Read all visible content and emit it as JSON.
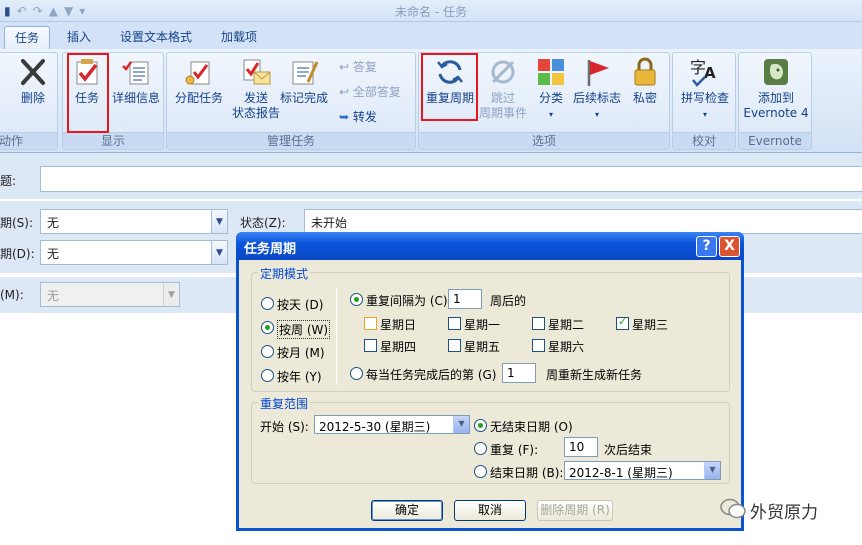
{
  "window": {
    "title": "未命名 - 任务",
    "qat_icons": [
      "save-icon",
      "undo-icon",
      "redo-icon",
      "up-icon",
      "down-icon"
    ]
  },
  "tabs": [
    "任务",
    "插入",
    "设置文本格式",
    "加载项"
  ],
  "ribbon": {
    "groups": {
      "actions": "动作",
      "show": "显示",
      "manage": "管理任务",
      "options": "选项",
      "proofing": "校对",
      "evernote": "Evernote"
    },
    "buttons": {
      "delete": "删除",
      "task": "任务",
      "details": "详细信息",
      "assign": "分配任务",
      "send_status_1": "发送",
      "send_status_2": "状态报告",
      "mark_complete": "标记完成",
      "reply": "答复",
      "reply_all": "全部答复",
      "forward": "转发",
      "recurrence": "重复周期",
      "skip_1": "跳过",
      "skip_2": "周期事件",
      "categorize": "分类",
      "followup": "后续标志",
      "private": "私密",
      "spelling": "拼写检查",
      "evernote_1": "添加到",
      "evernote_2": "Evernote 4"
    },
    "highlight_color": "#e8171d"
  },
  "form": {
    "subject_label": "题:",
    "start_label": "期(S):",
    "start_value": "无",
    "due_label": "期(D):",
    "due_value": "无",
    "status_label": "状态(Z):",
    "status_value": "未开始",
    "reminder_label": "(M):",
    "reminder_value": "无"
  },
  "dialog": {
    "title": "任务周期",
    "help": "?",
    "close": "X",
    "pattern_title": "定期模式",
    "daily": "按天 (D)",
    "weekly": "按周 (W)",
    "monthly": "按月 (M)",
    "yearly": "按年 (Y)",
    "recur_every": "重复间隔为 (C)",
    "recur_value": "1",
    "weeks_on": "周后的",
    "days": [
      "星期日",
      "星期一",
      "星期二",
      "星期三",
      "星期四",
      "星期五",
      "星期六"
    ],
    "days_checked": [
      false,
      false,
      false,
      true,
      false,
      false,
      false
    ],
    "regenerate": "每当任务完成后的第 (G)",
    "regenerate_value": "1",
    "regenerate_suffix": "周重新生成新任务",
    "range_title": "重复范围",
    "start_label": "开始 (S):",
    "start_value": "2012-5-30 (星期三)",
    "no_end": "无结束日期 (O)",
    "end_after": "重复 (F):",
    "end_after_value": "10",
    "end_after_suffix": "次后结束",
    "end_by": "结束日期 (B):",
    "end_by_value": "2012-8-1 (星期三)",
    "ok": "确定",
    "cancel": "取消",
    "remove": "删除周期 (R)"
  },
  "watermark": "外贸原力"
}
